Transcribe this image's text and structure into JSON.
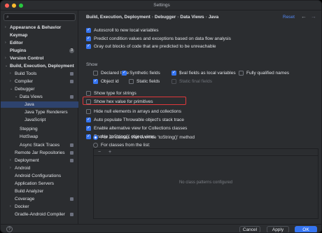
{
  "window": {
    "title": "Settings"
  },
  "search": {
    "placeholder": ""
  },
  "tree": [
    {
      "label": "Appearance & Behavior",
      "bold": true,
      "arrow": "›",
      "level": 0
    },
    {
      "label": "Keymap",
      "bold": true,
      "arrow": "",
      "level": 0
    },
    {
      "label": "Editor",
      "bold": true,
      "arrow": "›",
      "level": 0
    },
    {
      "label": "Plugins",
      "bold": true,
      "arrow": "",
      "level": 0,
      "badge": "3"
    },
    {
      "label": "Version Control",
      "bold": true,
      "arrow": "›",
      "level": 0
    },
    {
      "label": "Build, Execution, Deployment",
      "bold": true,
      "arrow": "⌄",
      "level": 0
    },
    {
      "label": "Build Tools",
      "bold": false,
      "arrow": "›",
      "level": 1
    },
    {
      "label": "Compiler",
      "bold": false,
      "arrow": "›",
      "level": 1
    },
    {
      "label": "Debugger",
      "bold": false,
      "arrow": "⌄",
      "level": 1
    },
    {
      "label": "Data Views",
      "bold": false,
      "arrow": "⌄",
      "level": 2
    },
    {
      "label": "Java",
      "bold": false,
      "arrow": "",
      "level": 3,
      "selected": true
    },
    {
      "label": "Java Type Renderers",
      "bold": false,
      "arrow": "",
      "level": 3
    },
    {
      "label": "JavaScript",
      "bold": false,
      "arrow": "",
      "level": 3
    },
    {
      "label": "Stepping",
      "bold": false,
      "arrow": "",
      "level": 2
    },
    {
      "label": "HotSwap",
      "bold": false,
      "arrow": "",
      "level": 2
    },
    {
      "label": "Async Stack Traces",
      "bold": false,
      "arrow": "",
      "level": 2
    },
    {
      "label": "Remote Jar Repositories",
      "bold": false,
      "arrow": "",
      "level": 1
    },
    {
      "label": "Deployment",
      "bold": false,
      "arrow": "›",
      "level": 1
    },
    {
      "label": "Android",
      "bold": false,
      "arrow": "›",
      "level": 1
    },
    {
      "label": "Android Configurations",
      "bold": false,
      "arrow": "",
      "level": 1
    },
    {
      "label": "Application Servers",
      "bold": false,
      "arrow": "",
      "level": 1
    },
    {
      "label": "Build Analyzer",
      "bold": false,
      "arrow": "",
      "level": 1
    },
    {
      "label": "Coverage",
      "bold": false,
      "arrow": "",
      "level": 1
    },
    {
      "label": "Docker",
      "bold": false,
      "arrow": "›",
      "level": 1
    },
    {
      "label": "Gradle-Android Compiler",
      "bold": false,
      "arrow": "",
      "level": 1
    }
  ],
  "breadcrumb": [
    "Build, Execution, Deployment",
    "Debugger",
    "Data Views",
    "Java"
  ],
  "reset_label": "Reset",
  "options_top": [
    {
      "label": "Autoscroll to new local variables",
      "checked": true
    },
    {
      "label": "Predict condition values and exceptions based on data flow analysis",
      "checked": true
    },
    {
      "label": "Gray out blocks of code that are predicted to be unreachable",
      "checked": true
    }
  ],
  "show_label": "Show",
  "show_options": [
    {
      "label": "Declared type",
      "checked": false
    },
    {
      "label": "Synthetic fields",
      "checked": true
    },
    {
      "label": "$val fields as local variables",
      "checked": true
    },
    {
      "label": "Fully qualified names",
      "checked": false
    },
    {
      "label": "Object id",
      "checked": true
    },
    {
      "label": "Static fields",
      "checked": false
    },
    {
      "label": "Static final fields",
      "checked": false,
      "disabled": true
    }
  ],
  "options_mid": [
    {
      "label": "Show type for strings",
      "checked": false
    },
    {
      "label": "Show hex value for primitives",
      "checked": false
    },
    {
      "label": "Hide null elements in arrays and collections",
      "checked": false
    },
    {
      "label": "Auto populate Throwable object's stack trace",
      "checked": true
    },
    {
      "label": "Enable alternative view for Collections classes",
      "checked": true
    },
    {
      "label": "Enable 'toString()' object view:",
      "checked": true
    }
  ],
  "radios": [
    {
      "label": "For all classes that override 'toString()' method",
      "selected": true
    },
    {
      "label": "For classes from the list:",
      "selected": false
    }
  ],
  "list_toolbar": {
    "add": "+",
    "remove": "−"
  },
  "list_empty": "No class patterns configured",
  "buttons": {
    "cancel": "Cancel",
    "apply": "Apply",
    "ok": "OK",
    "help": "?"
  },
  "colors": {
    "accent": "#3574f0",
    "highlight": "#e0383b",
    "selection": "#2e436e"
  }
}
